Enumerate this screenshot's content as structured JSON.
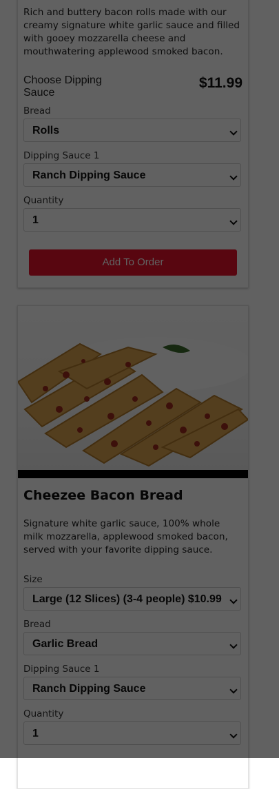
{
  "card1": {
    "description": "Rich and buttery bacon rolls made with our creamy signature white garlic sauce and filled with gooey mozzarella cheese and mouthwatering applewood smoked bacon.",
    "choose_label": "Choose Dipping Sauce",
    "price": "$11.99",
    "bread_label": "Bread",
    "bread_value": "Rolls",
    "dipping_label": "Dipping Sauce 1",
    "dipping_value": "Ranch Dipping Sauce",
    "quantity_label": "Quantity",
    "quantity_value": "1",
    "add_button": "Add To Order"
  },
  "card2": {
    "title": "Cheezee Bacon Bread",
    "description": "Signature white garlic sauce, 100% whole milk mozzarella, applewood smoked bacon, served with your favorite dipping sauce.",
    "size_label": "Size",
    "size_value": "Large (12 Slices) (3-4 people) $10.99",
    "bread_label": "Bread",
    "bread_value": "Garlic Bread",
    "dipping_label": "Dipping Sauce 1",
    "dipping_value": "Ranch Dipping Sauce",
    "quantity_label": "Quantity",
    "quantity_value": "1"
  },
  "colors": {
    "accent": "#e8102a",
    "overlay": "#000000"
  }
}
